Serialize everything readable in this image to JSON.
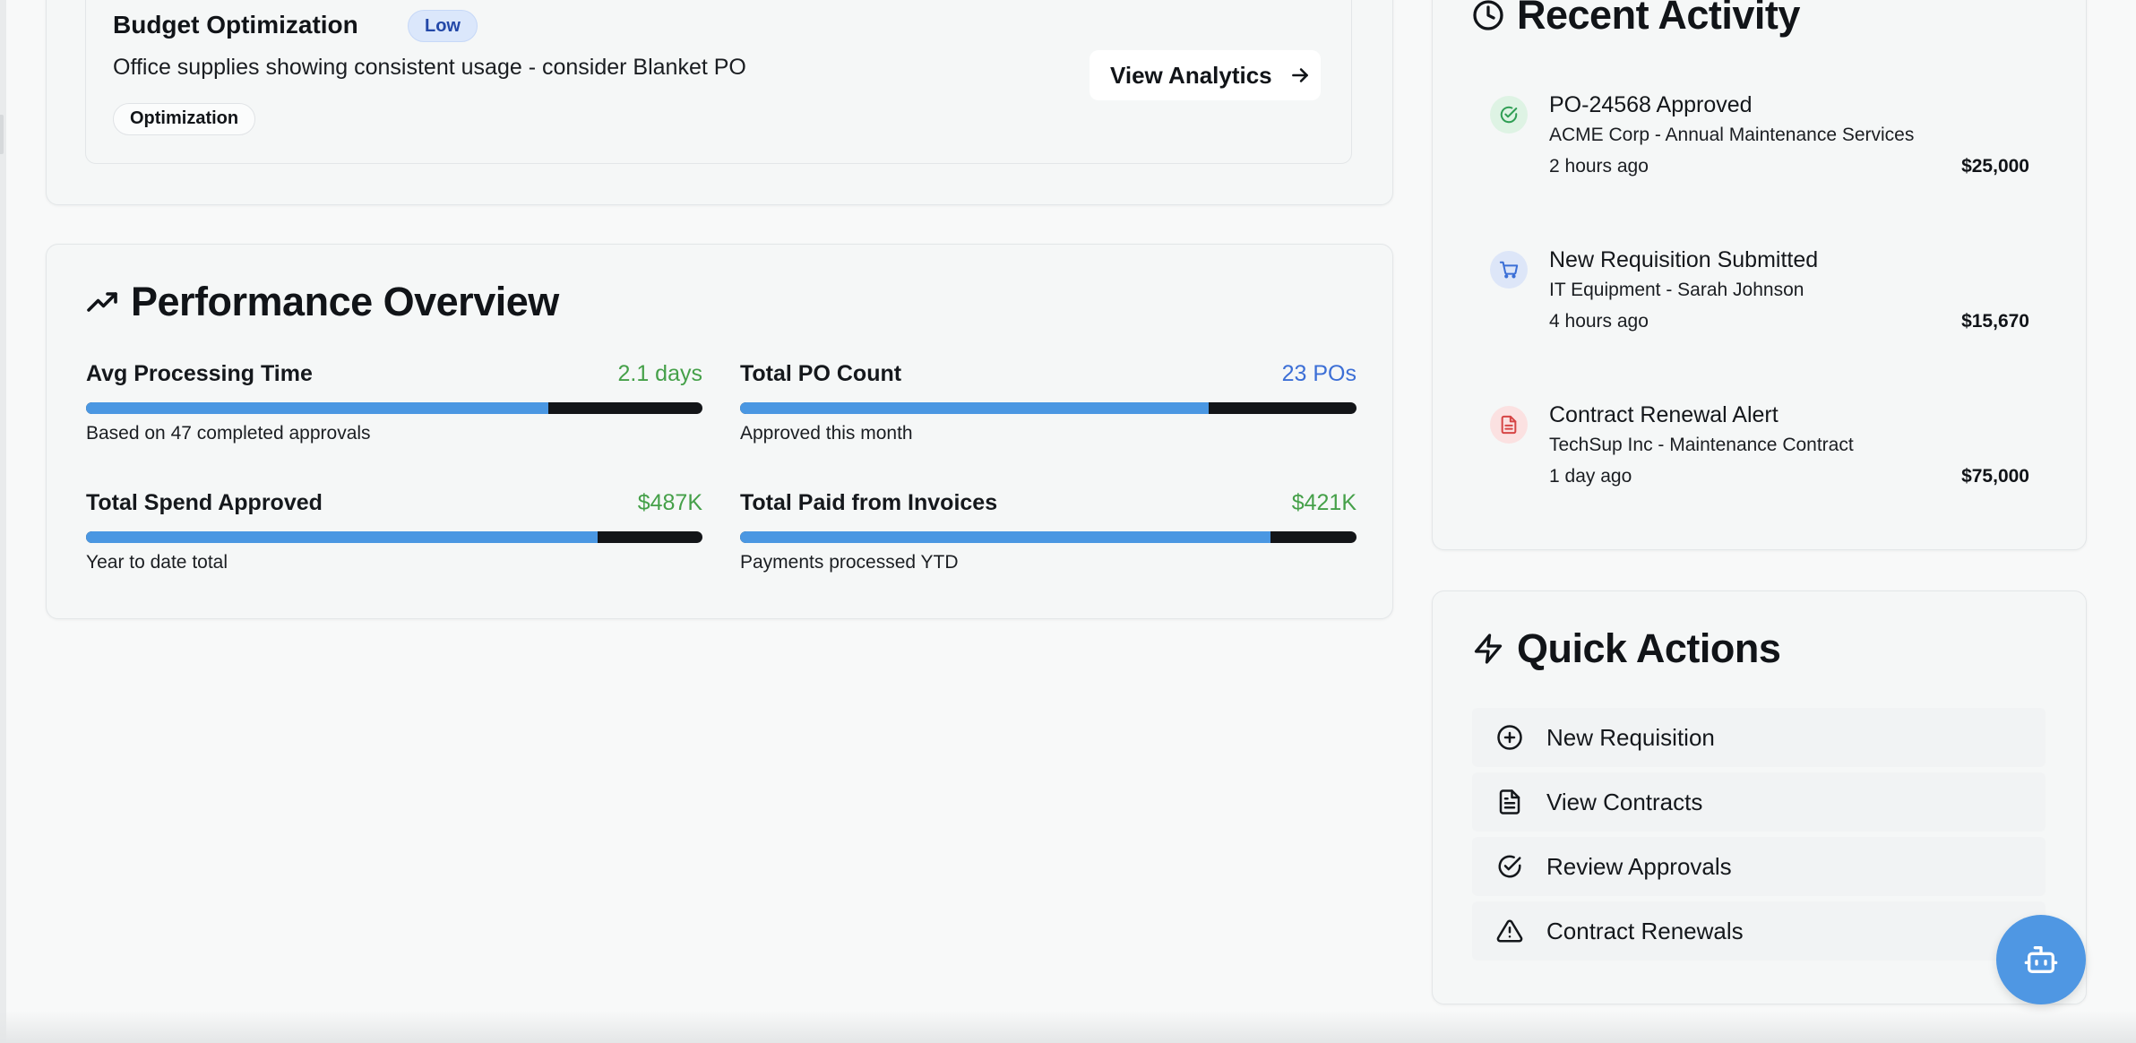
{
  "insight": {
    "title": "Budget Optimization",
    "priority": "Low",
    "description": "Office supplies showing consistent usage - consider Blanket PO",
    "tag": "Optimization",
    "action_label": "View Analytics"
  },
  "performance": {
    "title": "Performance Overview",
    "metrics": [
      {
        "label": "Avg Processing Time",
        "value": "2.1 days",
        "subtext": "Based on 47 completed approvals",
        "progress": 0.75,
        "value_color": "#45a049"
      },
      {
        "label": "Total PO Count",
        "value": "23 POs",
        "subtext": "Approved this month",
        "progress": 0.76,
        "value_color": "#3c6fd6"
      },
      {
        "label": "Total Spend Approved",
        "value": "$487K",
        "subtext": "Year to date total",
        "progress": 0.83,
        "value_color": "#45a049"
      },
      {
        "label": "Total Paid from Invoices",
        "value": "$421K",
        "subtext": "Payments processed YTD",
        "progress": 0.86,
        "value_color": "#45a049"
      }
    ]
  },
  "recent_activity": {
    "title": "Recent Activity",
    "items": [
      {
        "icon": "check-circle-icon",
        "title": "PO-24568 Approved",
        "subtitle": "ACME Corp - Annual Maintenance Services",
        "time": "2 hours ago",
        "amount": "$25,000",
        "color": "#2f9e54"
      },
      {
        "icon": "cart-icon",
        "title": "New Requisition Submitted",
        "subtitle": "IT Equipment - Sarah Johnson",
        "time": "4 hours ago",
        "amount": "$15,670",
        "color": "#3b6fd6"
      },
      {
        "icon": "document-icon",
        "title": "Contract Renewal Alert",
        "subtitle": "TechSup Inc - Maintenance Contract",
        "time": "1 day ago",
        "amount": "$75,000",
        "color": "#d64545"
      }
    ]
  },
  "quick_actions": {
    "title": "Quick Actions",
    "items": [
      {
        "icon": "plus-circle-icon",
        "label": "New Requisition"
      },
      {
        "icon": "file-text-icon",
        "label": "View Contracts"
      },
      {
        "icon": "check-circle-icon",
        "label": "Review Approvals"
      },
      {
        "icon": "alert-triangle-icon",
        "label": "Contract Renewals"
      }
    ]
  },
  "colors": {
    "accent_blue": "#4a97e2",
    "success_green": "#45a049",
    "info_blue": "#3c6fd6",
    "fab": "#4f97e3"
  },
  "fab": {
    "icon": "bot-icon"
  }
}
